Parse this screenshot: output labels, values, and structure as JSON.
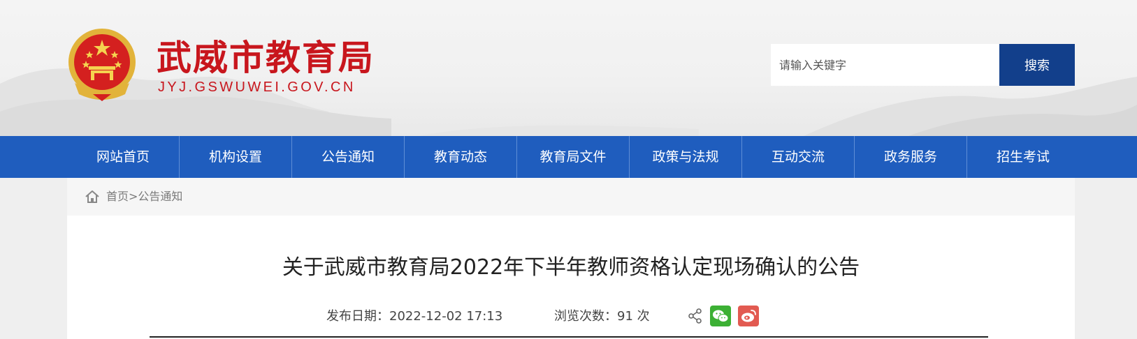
{
  "header": {
    "site_title": "武威市教育局",
    "site_domain": "JYJ.GSWUWEI.GOV.CN",
    "emblem_icon": "national-emblem-icon",
    "search": {
      "placeholder": "请输入关键字",
      "value": "",
      "button_label": "搜索"
    }
  },
  "nav": {
    "items": [
      {
        "label": "网站首页"
      },
      {
        "label": "机构设置"
      },
      {
        "label": "公告通知"
      },
      {
        "label": "教育动态"
      },
      {
        "label": "教育局文件"
      },
      {
        "label": "政策与法规"
      },
      {
        "label": "互动交流"
      },
      {
        "label": "政务服务"
      },
      {
        "label": "招生考试"
      }
    ]
  },
  "breadcrumb": {
    "icon": "home-icon",
    "home": "首页",
    "separator": ">",
    "current": "公告通知"
  },
  "article": {
    "title": "关于武威市教育局2022年下半年教师资格认定现场确认的公告",
    "publish_label": "发布日期：",
    "publish_date": "2022-12-02 17:13",
    "views_label": "浏览次数：",
    "views_count": "91",
    "views_unit": "次",
    "share_icons": [
      "share-icon",
      "wechat-icon",
      "weibo-icon"
    ]
  },
  "colors": {
    "brand_red": "#c8161d",
    "nav_blue": "#1f5dbe",
    "search_button": "#123f8b",
    "wechat_green": "#3cb034",
    "weibo_red": "#e25a51"
  }
}
